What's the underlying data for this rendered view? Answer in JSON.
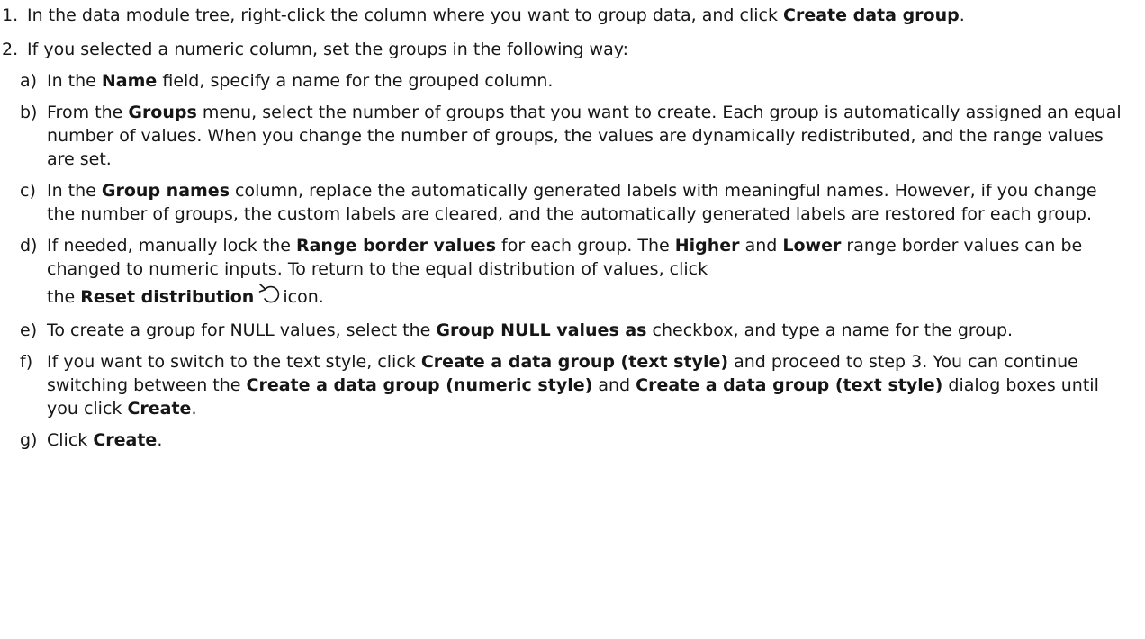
{
  "steps": [
    {
      "num": "1.",
      "t1": "In the data module tree, right-click the column where you want to group data, and click ",
      "b1": "Create data group",
      "t2": "."
    },
    {
      "num": "2.",
      "t1": "If you selected a numeric column, set the groups in the following way:"
    }
  ],
  "substeps": {
    "a": {
      "letter": "a)",
      "t1": "In the ",
      "b1": "Name",
      "t2": " field, specify a name for the grouped column."
    },
    "b": {
      "letter": "b)",
      "t1": "From the ",
      "b1": "Groups",
      "t2": " menu, select the number of groups that you want to create. Each group is automatically assigned an equal number of values. When you change the number of groups, the values are dynamically redistributed, and the range values are set."
    },
    "c": {
      "letter": "c)",
      "t1": "In the ",
      "b1": "Group names",
      "t2": " column, replace the automatically generated labels with meaningful names. However, if you change the number of groups, the custom labels are cleared, and the automatically generated labels are restored for each group."
    },
    "d": {
      "letter": "d)",
      "t1": "If needed, manually lock the ",
      "b1": "Range border values",
      "t2": " for each group. The ",
      "b2": "Higher",
      "t3": " and ",
      "b3": "Lower",
      "t4": " range border values can be changed to numeric inputs. To return to the equal distribution of values, click",
      "t5": "the ",
      "b4": "Reset distribution",
      "icon": "reset-distribution-icon",
      "t6": "icon."
    },
    "e": {
      "letter": "e)",
      "t1": "To create a group for NULL values, select the ",
      "b1": "Group NULL values as",
      "t2": " checkbox, and type a name for the group."
    },
    "f": {
      "letter": "f)",
      "t1": "If you want to switch to the text style, click ",
      "b1": "Create a data group (text style)",
      "t2": " and proceed to step 3. You can continue switching between the ",
      "b2": "Create a data group (numeric style)",
      "t3": " and ",
      "b3": "Create a data group (text style)",
      "t4": " dialog boxes until you click ",
      "b4": "Create",
      "t5": "."
    },
    "g": {
      "letter": "g)",
      "t1": "Click ",
      "b1": "Create",
      "t2": "."
    }
  }
}
